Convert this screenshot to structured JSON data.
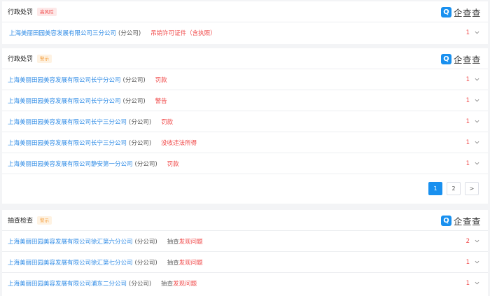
{
  "section1": {
    "title": "行政处罚",
    "tag": "高风险",
    "logo_mark": "Q",
    "logo_text": "企查查",
    "rows": [
      {
        "company": "上海美丽田园美容发展有限公司三分公司",
        "branch": "(分公司)",
        "result": "吊销许可证件（含执照）",
        "count": "1"
      }
    ]
  },
  "section2": {
    "title": "行政处罚",
    "tag": "警示",
    "logo_mark": "Q",
    "logo_text": "企查查",
    "rows": [
      {
        "company": "上海美丽田园美容发展有限公司长宁分公司",
        "branch": "(分公司)",
        "result": "罚款",
        "count": "1"
      },
      {
        "company": "上海美丽田园美容发展有限公司长宁分公司",
        "branch": "(分公司)",
        "result": "警告",
        "count": "1"
      },
      {
        "company": "上海美丽田园美容发展有限公司长宁三分公司",
        "branch": "(分公司)",
        "result": "罚款",
        "count": "1"
      },
      {
        "company": "上海美丽田园美容发展有限公司长宁三分公司",
        "branch": "(分公司)",
        "result": "没收违法所得",
        "count": "1"
      },
      {
        "company": "上海美丽田园美容发展有限公司静安第一分公司",
        "branch": "(分公司)",
        "result": "罚款",
        "count": "1"
      }
    ],
    "pagination": {
      "pages": [
        "1",
        "2"
      ],
      "next": ">"
    }
  },
  "section3": {
    "title": "抽查检查",
    "tag": "警示",
    "logo_mark": "Q",
    "logo_text": "企查查",
    "rows": [
      {
        "company": "上海美丽田园美容发展有限公司徐汇第六分公司",
        "branch": "(分公司)",
        "prefix": "抽查",
        "result": "发现问题",
        "count": "2"
      },
      {
        "company": "上海美丽田园美容发展有限公司徐汇第七分公司",
        "branch": "(分公司)",
        "prefix": "抽查",
        "result": "发现问题",
        "count": "1"
      },
      {
        "company": "上海美丽田园美容发展有限公司浦东二分公司",
        "branch": "(分公司)",
        "prefix": "抽查",
        "result": "发现问题",
        "count": "1"
      }
    ]
  },
  "colors": {
    "link": "#2f8be6",
    "danger": "#f04747",
    "brand": "#1990ef",
    "warn": "#f5a142"
  }
}
